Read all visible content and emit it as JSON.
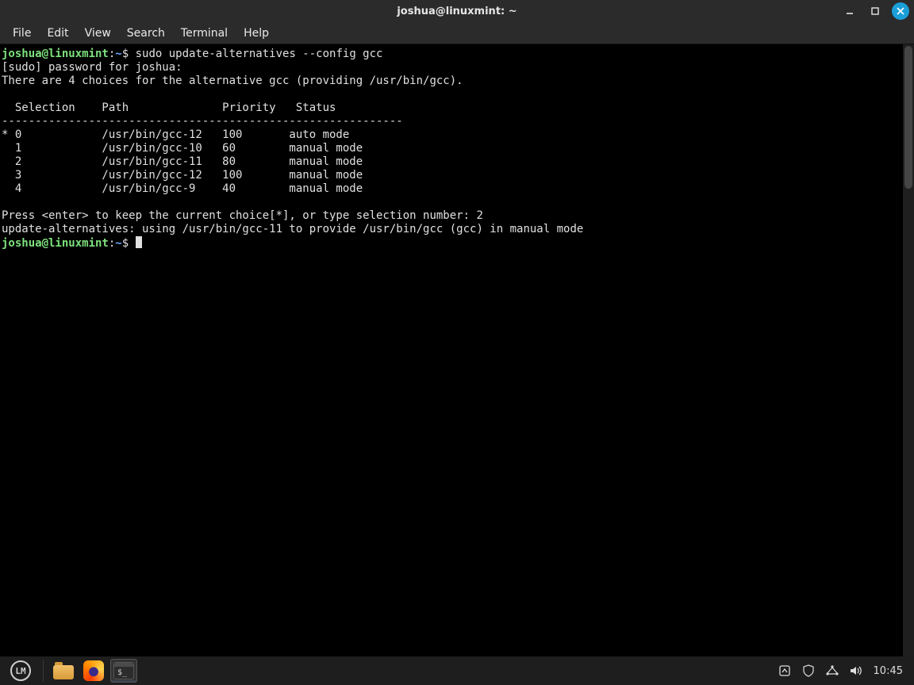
{
  "window": {
    "title": "joshua@linuxmint: ~"
  },
  "menubar": {
    "items": [
      "File",
      "Edit",
      "View",
      "Search",
      "Terminal",
      "Help"
    ]
  },
  "terminal": {
    "prompt_user": "joshua@linuxmint",
    "prompt_sep1": ":",
    "prompt_path": "~",
    "prompt_sep2": "$ ",
    "cmd1": "sudo update-alternatives --config gcc",
    "line_sudo": "[sudo] password for joshua:",
    "line_intro": "There are 4 choices for the alternative gcc (providing /usr/bin/gcc).",
    "header": "  Selection    Path              Priority   Status",
    "divider": "------------------------------------------------------------",
    "rows": [
      "* 0            /usr/bin/gcc-12   100       auto mode",
      "  1            /usr/bin/gcc-10   60        manual mode",
      "  2            /usr/bin/gcc-11   80        manual mode",
      "  3            /usr/bin/gcc-12   100       manual mode",
      "  4            /usr/bin/gcc-9    40        manual mode"
    ],
    "line_press": "Press <enter> to keep the current choice[*], or type selection number: 2",
    "line_result": "update-alternatives: using /usr/bin/gcc-11 to provide /usr/bin/gcc (gcc) in manual mode"
  },
  "taskbar": {
    "logo_text": "LM",
    "clock": "10:45"
  }
}
